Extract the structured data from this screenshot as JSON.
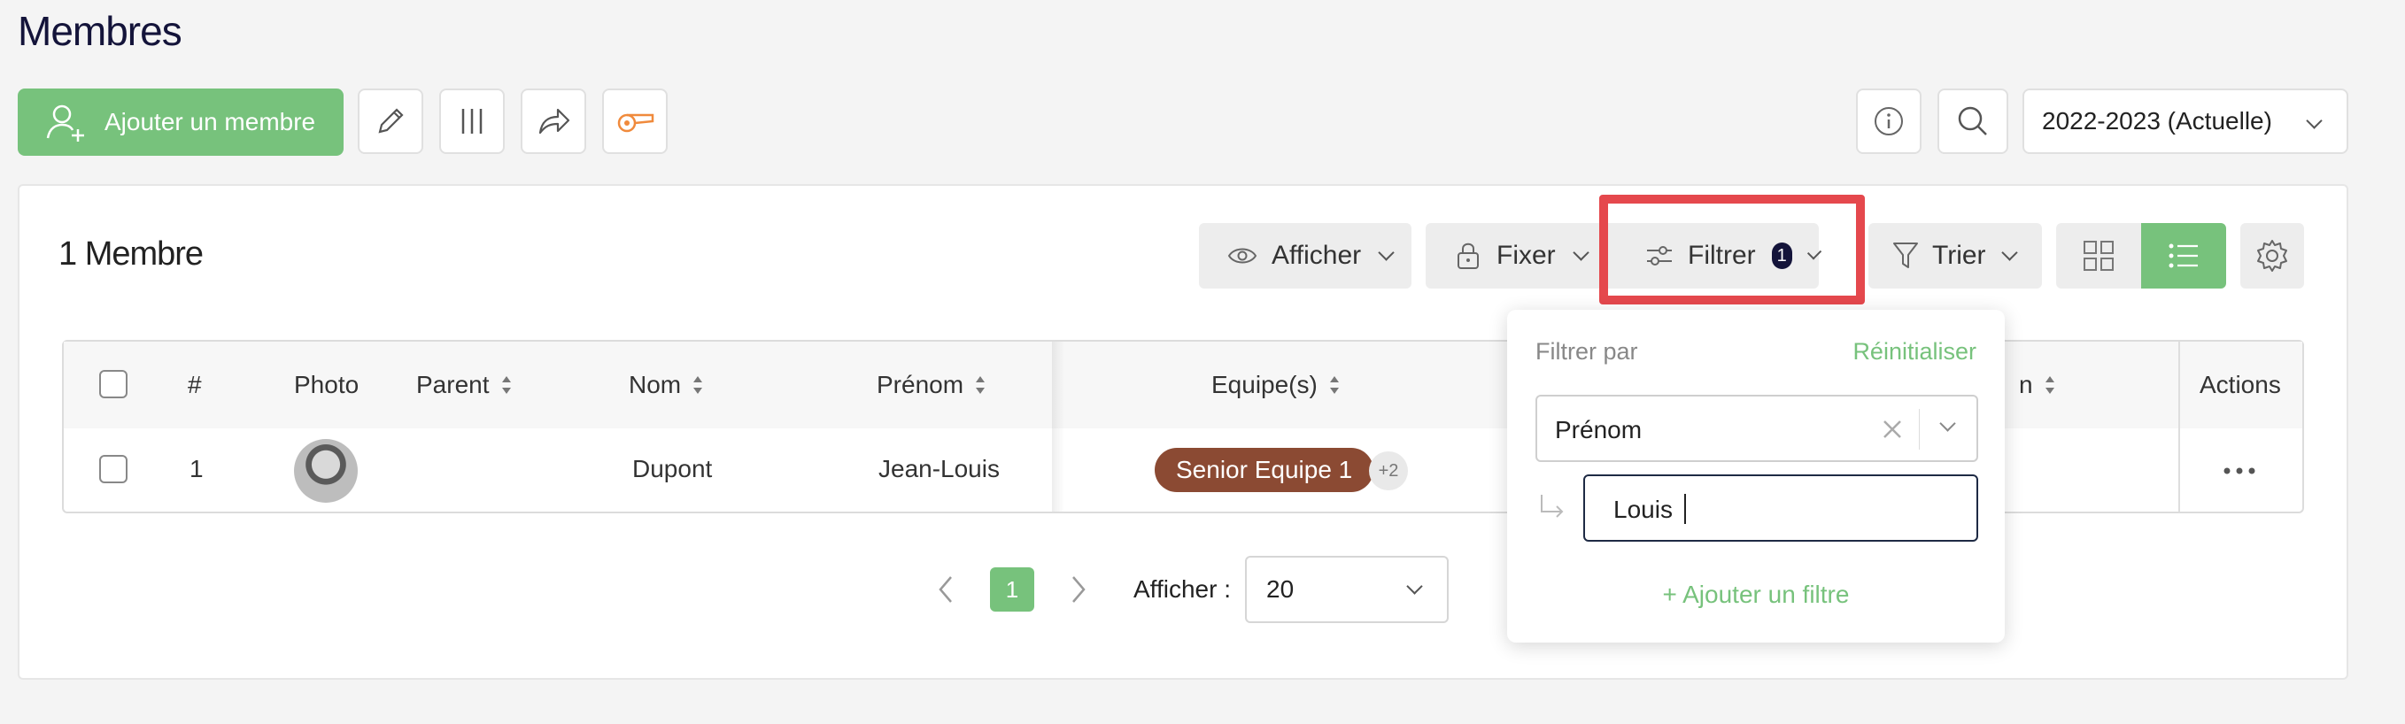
{
  "page": {
    "title": "Membres"
  },
  "toolbar": {
    "add_member_label": "Ajouter un membre",
    "season_select": "2022-2023 (Actuelle)"
  },
  "panel": {
    "count_label": "1 Membre",
    "controls": {
      "show_label": "Afficher",
      "fix_label": "Fixer",
      "filter_label": "Filtrer",
      "filter_count": "1",
      "sort_label": "Trier"
    }
  },
  "table": {
    "columns": [
      "#",
      "Photo",
      "Parent",
      "Nom",
      "Prénom",
      "Equipe(s)",
      "n",
      "Actions"
    ],
    "rows": [
      {
        "index": "1",
        "parent": "",
        "nom": "Dupont",
        "prenom": "Jean-Louis",
        "team": "Senior Equipe 1",
        "more_teams": "+2"
      }
    ]
  },
  "pagination": {
    "current_page": "1",
    "per_page_label": "Afficher :",
    "per_page_value": "20"
  },
  "filter_dropdown": {
    "title": "Filtrer par",
    "reset_label": "Réinitialiser",
    "field_value": "Prénom",
    "input_value": "Louis",
    "add_filter_label": "+ Ajouter un filtre"
  },
  "colors": {
    "accent_green": "#77c27c",
    "highlight_red": "#e5484d",
    "team_badge": "#8b4a33",
    "whistle_orange": "#f08a3c"
  }
}
